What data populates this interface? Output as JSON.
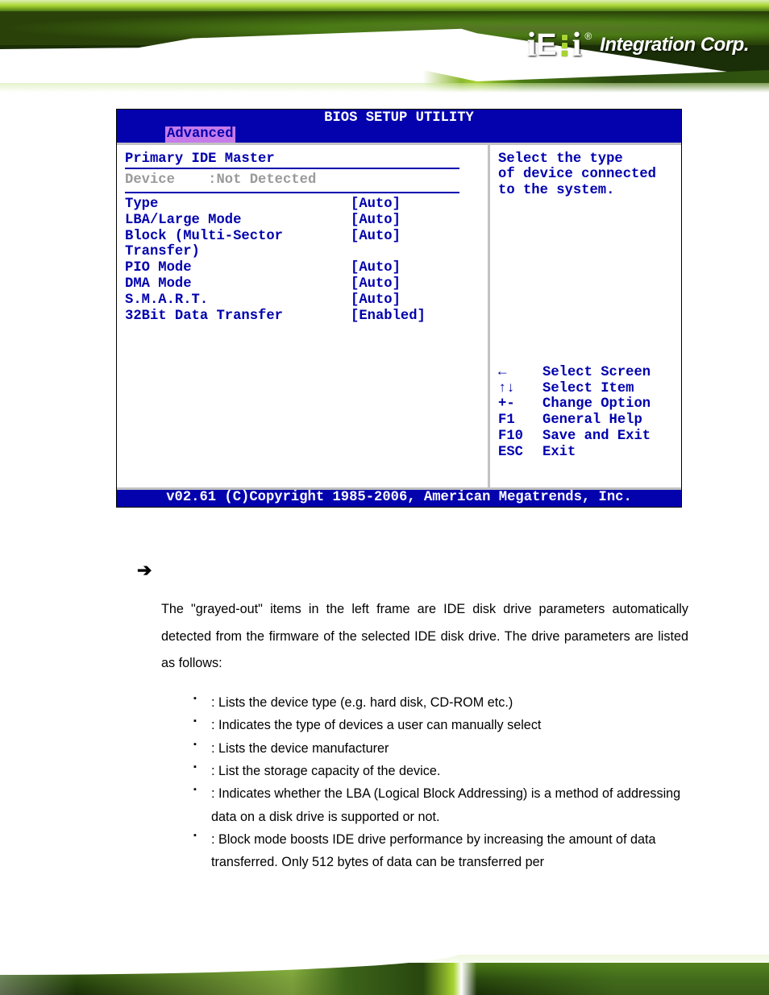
{
  "header": {
    "logo_text_1": "i",
    "logo_text_2": "E",
    "logo_text_3": "i",
    "logo_reg": "®",
    "brand": "Integration Corp."
  },
  "bios": {
    "title": "BIOS SETUP UTILITY",
    "tab": "Advanced",
    "heading": "Primary IDE Master",
    "device_label": "Device",
    "device_sep": ":",
    "device_value": "Not Detected",
    "settings": [
      {
        "label": "Type",
        "value": "[Auto]"
      },
      {
        "label": "LBA/Large Mode",
        "value": "[Auto]"
      },
      {
        "label": "Block (Multi-Sector Transfer)",
        "value": "[Auto]"
      },
      {
        "label": "PIO Mode",
        "value": "[Auto]"
      },
      {
        "label": "DMA Mode",
        "value": "[Auto]"
      },
      {
        "label": "S.M.A.R.T.",
        "value": "[Auto]"
      },
      {
        "label": "32Bit Data Transfer",
        "value": "[Enabled]"
      }
    ],
    "desc_lines": [
      "Select the type",
      "of device connected",
      "to the system."
    ],
    "help": [
      {
        "key": "←",
        "txt": "Select Screen"
      },
      {
        "key": "↑↓",
        "txt": "Select Item"
      },
      {
        "key": "+-",
        "txt": "Change Option"
      },
      {
        "key": "F1",
        "txt": "General Help"
      },
      {
        "key": "F10",
        "txt": "Save and Exit"
      },
      {
        "key": "ESC",
        "txt": "Exit"
      }
    ],
    "footer": "v02.61 (C)Copyright 1985-2006, American Megatrends, Inc."
  },
  "body": {
    "arrow": "➔",
    "para": "The \"grayed-out\" items in the left frame are IDE disk drive parameters automatically detected from the firmware of the selected IDE disk drive. The drive parameters are listed as follows:",
    "bullets": [
      ": Lists the device type (e.g. hard disk, CD-ROM etc.)",
      ": Indicates the type of devices a user can manually select",
      ": Lists the device manufacturer",
      ": List the storage capacity of the device.",
      ": Indicates whether the LBA (Logical Block Addressing) is a method of addressing data on a disk drive is supported or not.",
      ": Block mode boosts IDE drive performance by increasing the amount of data transferred. Only 512 bytes of data can be transferred per"
    ]
  }
}
